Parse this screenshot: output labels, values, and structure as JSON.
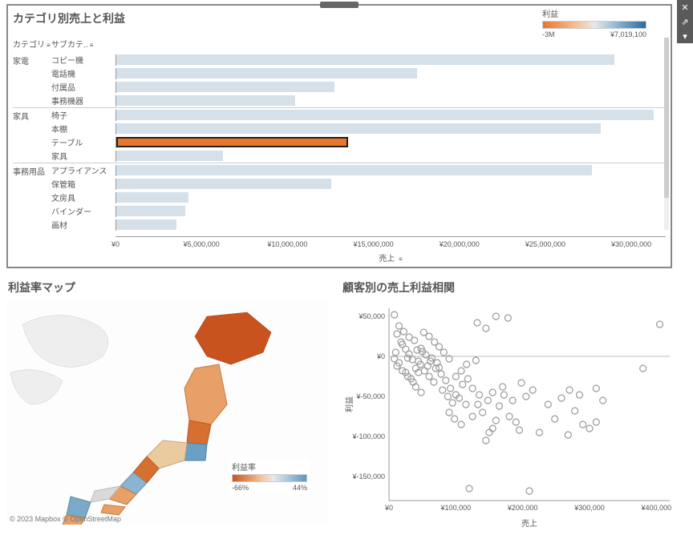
{
  "top": {
    "title": "カテゴリ別売上と利益",
    "cat_header": "カテゴリ",
    "sub_header": "サブカテ..",
    "legend_title": "利益",
    "legend_min": "-3M",
    "legend_max": "¥7,019,100",
    "x_label": "売上"
  },
  "map": {
    "title": "利益率マップ",
    "legend_title": "利益率",
    "legend_min": "-66%",
    "legend_max": "44%",
    "credit": "© 2023 Mapbox © OpenStreetMap"
  },
  "scatter": {
    "title": "顧客別の売上利益相関",
    "x_label": "売上",
    "y_label": "利益"
  },
  "chart_data": [
    {
      "type": "bar",
      "title": "カテゴリ別売上と利益",
      "xlabel": "売上",
      "x_ticks": [
        "¥0",
        "¥5,000,000",
        "¥10,000,000",
        "¥15,000,000",
        "¥20,000,000",
        "¥25,000,000",
        "¥30,000,000"
      ],
      "xlim": [
        0,
        32000000
      ],
      "color_legend": {
        "title": "利益",
        "min": -3000000,
        "max": 7019100
      },
      "groups": [
        {
          "category": "家電",
          "rows": [
            {
              "sub": "コピー機",
              "value": 29000000,
              "highlight": false
            },
            {
              "sub": "電話機",
              "value": 17500000,
              "highlight": false
            },
            {
              "sub": "付属品",
              "value": 12700000,
              "highlight": false
            },
            {
              "sub": "事務機器",
              "value": 10400000,
              "highlight": false
            }
          ]
        },
        {
          "category": "家具",
          "rows": [
            {
              "sub": "椅子",
              "value": 31300000,
              "highlight": false
            },
            {
              "sub": "本棚",
              "value": 28200000,
              "highlight": false
            },
            {
              "sub": "テーブル",
              "value": 13500000,
              "highlight": true
            },
            {
              "sub": "家具",
              "value": 6200000,
              "highlight": false
            }
          ]
        },
        {
          "category": "事務用品",
          "rows": [
            {
              "sub": "アプライアンス",
              "value": 27700000,
              "highlight": false
            },
            {
              "sub": "保管箱",
              "value": 12500000,
              "highlight": false
            },
            {
              "sub": "文房具",
              "value": 4200000,
              "highlight": false
            },
            {
              "sub": "バインダー",
              "value": 4000000,
              "highlight": false
            },
            {
              "sub": "画材",
              "value": 3500000,
              "highlight": false
            }
          ]
        }
      ]
    },
    {
      "type": "heatmap",
      "title": "利益率マップ",
      "color_legend": {
        "title": "利益率",
        "min": -0.66,
        "max": 0.44
      },
      "note": "Choropleth map of Japan prefectures colored by profit ratio"
    },
    {
      "type": "scatter",
      "title": "顧客別の売上利益相関",
      "xlabel": "売上",
      "ylabel": "利益",
      "xlim": [
        0,
        420000
      ],
      "ylim": [
        -180000,
        60000
      ],
      "x_ticks": [
        "¥0",
        "¥100,000",
        "¥200,000",
        "¥300,000",
        "¥400,000"
      ],
      "y_ticks": [
        "¥50,000",
        "¥0",
        "¥-50,000",
        "¥-100,000",
        "¥-150,000"
      ],
      "points": [
        [
          8000,
          52000
        ],
        [
          15000,
          38000
        ],
        [
          22000,
          31000
        ],
        [
          30000,
          24000
        ],
        [
          38000,
          20000
        ],
        [
          48000,
          10000
        ],
        [
          55000,
          2000
        ],
        [
          62000,
          -6000
        ],
        [
          70000,
          -15000
        ],
        [
          78000,
          -22000
        ],
        [
          85000,
          -30000
        ],
        [
          92000,
          -40000
        ],
        [
          100000,
          -48000
        ],
        [
          30000,
          3000
        ],
        [
          35000,
          -4000
        ],
        [
          42000,
          8000
        ],
        [
          47000,
          -10000
        ],
        [
          53000,
          -18000
        ],
        [
          60000,
          -25000
        ],
        [
          67000,
          -32000
        ],
        [
          75000,
          -14000
        ],
        [
          80000,
          -42000
        ],
        [
          88000,
          -50000
        ],
        [
          95000,
          -58000
        ],
        [
          105000,
          -52000
        ],
        [
          110000,
          -35000
        ],
        [
          118000,
          -28000
        ],
        [
          125000,
          -40000
        ],
        [
          133000,
          -60000
        ],
        [
          140000,
          -70000
        ],
        [
          148000,
          -55000
        ],
        [
          155000,
          -45000
        ],
        [
          165000,
          -62000
        ],
        [
          172000,
          -48000
        ],
        [
          180000,
          -75000
        ],
        [
          190000,
          -82000
        ],
        [
          198000,
          -33000
        ],
        [
          205000,
          -50000
        ],
        [
          215000,
          -42000
        ],
        [
          225000,
          -95000
        ],
        [
          238000,
          -60000
        ],
        [
          248000,
          -78000
        ],
        [
          258000,
          -52000
        ],
        [
          268000,
          -98000
        ],
        [
          278000,
          -68000
        ],
        [
          290000,
          -85000
        ],
        [
          300000,
          -90000
        ],
        [
          310000,
          -82000
        ],
        [
          320000,
          -55000
        ],
        [
          20000,
          15000
        ],
        [
          25000,
          9000
        ],
        [
          28000,
          -2000
        ],
        [
          12000,
          28000
        ],
        [
          18000,
          18000
        ],
        [
          44000,
          -6000
        ],
        [
          50000,
          6000
        ],
        [
          58000,
          -12000
        ],
        [
          64000,
          -2000
        ],
        [
          72000,
          -8000
        ],
        [
          120000,
          -165000
        ],
        [
          210000,
          -168000
        ],
        [
          405000,
          40000
        ],
        [
          310000,
          -40000
        ],
        [
          380000,
          -15000
        ],
        [
          132000,
          42000
        ],
        [
          145000,
          35000
        ],
        [
          160000,
          50000
        ],
        [
          178000,
          48000
        ],
        [
          40000,
          -38000
        ],
        [
          48000,
          -45000
        ],
        [
          90000,
          -70000
        ],
        [
          98000,
          -78000
        ],
        [
          108000,
          -85000
        ],
        [
          115000,
          -60000
        ],
        [
          125000,
          -75000
        ],
        [
          135000,
          -48000
        ],
        [
          150000,
          -95000
        ],
        [
          160000,
          -80000
        ],
        [
          170000,
          -38000
        ],
        [
          185000,
          -55000
        ],
        [
          195000,
          -92000
        ],
        [
          52000,
          30000
        ],
        [
          60000,
          25000
        ],
        [
          68000,
          18000
        ],
        [
          75000,
          12000
        ],
        [
          82000,
          5000
        ],
        [
          90000,
          -3000
        ],
        [
          25000,
          -20000
        ],
        [
          33000,
          -28000
        ],
        [
          40000,
          -15000
        ],
        [
          15000,
          -8000
        ],
        [
          10000,
          5000
        ],
        [
          8000,
          -3000
        ],
        [
          12000,
          -12000
        ],
        [
          20000,
          -18000
        ],
        [
          28000,
          -25000
        ],
        [
          36000,
          -32000
        ],
        [
          44000,
          -20000
        ],
        [
          270000,
          -42000
        ],
        [
          285000,
          -48000
        ],
        [
          145000,
          -105000
        ],
        [
          155000,
          -90000
        ],
        [
          100000,
          -25000
        ],
        [
          108000,
          -18000
        ],
        [
          116000,
          -10000
        ],
        [
          130000,
          -5000
        ]
      ]
    }
  ]
}
